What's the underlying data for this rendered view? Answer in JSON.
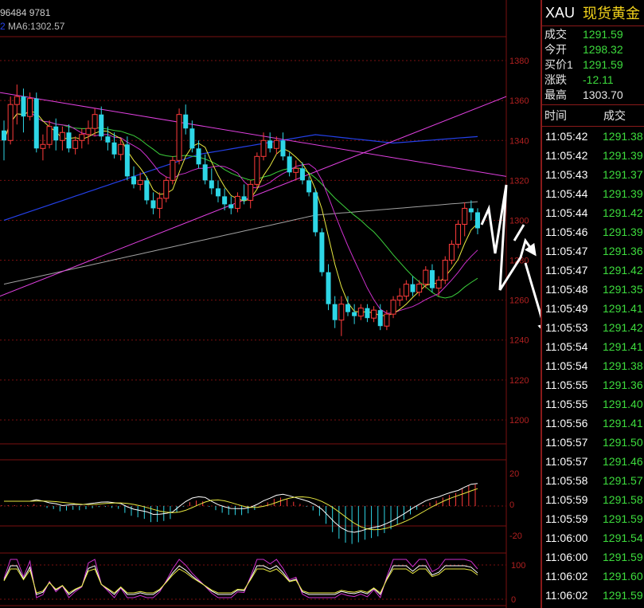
{
  "header": {
    "topline": "96484 9781",
    "ma_prefix": "2",
    "ma_label": "MA6:1302.57"
  },
  "colors": {
    "up": "#ff3b3b",
    "down": "#2ed6e6",
    "grid": "#7a0f0f",
    "axis_text": "#b02020",
    "trend": "#e040e0",
    "ma_yellow": "#e8e840",
    "ma_green": "#3ccf3c",
    "ma_blue": "#2440e8",
    "ma_gray": "#a0a0a0",
    "ma_magenta": "#cc30cc",
    "arrow": "#ffffff"
  },
  "chart_data": {
    "type": "candlestick",
    "y_ticks": [
      "1380",
      "1360",
      "1340",
      "1320",
      "1300",
      "1280",
      "1260",
      "1240",
      "1220",
      "1200"
    ],
    "ylim": [
      1188,
      1392
    ],
    "candles": [
      {
        "o": 1345,
        "h": 1350,
        "l": 1330,
        "c": 1340
      },
      {
        "o": 1340,
        "h": 1362,
        "l": 1338,
        "c": 1358
      },
      {
        "o": 1358,
        "h": 1368,
        "l": 1348,
        "c": 1362
      },
      {
        "o": 1362,
        "h": 1366,
        "l": 1344,
        "c": 1352
      },
      {
        "o": 1352,
        "h": 1364,
        "l": 1350,
        "c": 1361
      },
      {
        "o": 1361,
        "h": 1364,
        "l": 1334,
        "c": 1336
      },
      {
        "o": 1336,
        "h": 1343,
        "l": 1330,
        "c": 1338
      },
      {
        "o": 1338,
        "h": 1350,
        "l": 1336,
        "c": 1347
      },
      {
        "o": 1347,
        "h": 1351,
        "l": 1335,
        "c": 1340
      },
      {
        "o": 1340,
        "h": 1347,
        "l": 1335,
        "c": 1344
      },
      {
        "o": 1344,
        "h": 1348,
        "l": 1334,
        "c": 1336
      },
      {
        "o": 1336,
        "h": 1342,
        "l": 1333,
        "c": 1340
      },
      {
        "o": 1340,
        "h": 1346,
        "l": 1336,
        "c": 1343
      },
      {
        "o": 1343,
        "h": 1350,
        "l": 1338,
        "c": 1346
      },
      {
        "o": 1346,
        "h": 1356,
        "l": 1342,
        "c": 1353
      },
      {
        "o": 1353,
        "h": 1357,
        "l": 1340,
        "c": 1342
      },
      {
        "o": 1342,
        "h": 1347,
        "l": 1335,
        "c": 1339
      },
      {
        "o": 1339,
        "h": 1344,
        "l": 1331,
        "c": 1333
      },
      {
        "o": 1333,
        "h": 1341,
        "l": 1330,
        "c": 1338
      },
      {
        "o": 1338,
        "h": 1342,
        "l": 1320,
        "c": 1322
      },
      {
        "o": 1322,
        "h": 1327,
        "l": 1316,
        "c": 1318
      },
      {
        "o": 1318,
        "h": 1324,
        "l": 1315,
        "c": 1320
      },
      {
        "o": 1320,
        "h": 1322,
        "l": 1308,
        "c": 1310
      },
      {
        "o": 1310,
        "h": 1314,
        "l": 1303,
        "c": 1306
      },
      {
        "o": 1306,
        "h": 1314,
        "l": 1301,
        "c": 1311
      },
      {
        "o": 1311,
        "h": 1322,
        "l": 1309,
        "c": 1320
      },
      {
        "o": 1320,
        "h": 1332,
        "l": 1318,
        "c": 1330
      },
      {
        "o": 1330,
        "h": 1356,
        "l": 1328,
        "c": 1353
      },
      {
        "o": 1353,
        "h": 1358,
        "l": 1343,
        "c": 1346
      },
      {
        "o": 1346,
        "h": 1350,
        "l": 1334,
        "c": 1336
      },
      {
        "o": 1336,
        "h": 1340,
        "l": 1326,
        "c": 1328
      },
      {
        "o": 1328,
        "h": 1333,
        "l": 1318,
        "c": 1320
      },
      {
        "o": 1320,
        "h": 1326,
        "l": 1313,
        "c": 1316
      },
      {
        "o": 1316,
        "h": 1320,
        "l": 1309,
        "c": 1312
      },
      {
        "o": 1312,
        "h": 1316,
        "l": 1305,
        "c": 1308
      },
      {
        "o": 1308,
        "h": 1312,
        "l": 1303,
        "c": 1306
      },
      {
        "o": 1306,
        "h": 1314,
        "l": 1304,
        "c": 1312
      },
      {
        "o": 1312,
        "h": 1318,
        "l": 1308,
        "c": 1310
      },
      {
        "o": 1310,
        "h": 1320,
        "l": 1306,
        "c": 1318
      },
      {
        "o": 1318,
        "h": 1334,
        "l": 1316,
        "c": 1332
      },
      {
        "o": 1332,
        "h": 1344,
        "l": 1330,
        "c": 1340
      },
      {
        "o": 1340,
        "h": 1344,
        "l": 1334,
        "c": 1336
      },
      {
        "o": 1336,
        "h": 1342,
        "l": 1333,
        "c": 1340
      },
      {
        "o": 1340,
        "h": 1344,
        "l": 1330,
        "c": 1332
      },
      {
        "o": 1332,
        "h": 1334,
        "l": 1322,
        "c": 1324
      },
      {
        "o": 1324,
        "h": 1330,
        "l": 1320,
        "c": 1326
      },
      {
        "o": 1326,
        "h": 1329,
        "l": 1318,
        "c": 1320
      },
      {
        "o": 1320,
        "h": 1322,
        "l": 1312,
        "c": 1314
      },
      {
        "o": 1314,
        "h": 1316,
        "l": 1292,
        "c": 1294
      },
      {
        "o": 1294,
        "h": 1296,
        "l": 1272,
        "c": 1274
      },
      {
        "o": 1274,
        "h": 1278,
        "l": 1255,
        "c": 1258
      },
      {
        "o": 1258,
        "h": 1262,
        "l": 1246,
        "c": 1250
      },
      {
        "o": 1250,
        "h": 1262,
        "l": 1242,
        "c": 1258
      },
      {
        "o": 1258,
        "h": 1262,
        "l": 1252,
        "c": 1254
      },
      {
        "o": 1254,
        "h": 1258,
        "l": 1248,
        "c": 1252
      },
      {
        "o": 1252,
        "h": 1258,
        "l": 1250,
        "c": 1256
      },
      {
        "o": 1256,
        "h": 1258,
        "l": 1249,
        "c": 1251
      },
      {
        "o": 1251,
        "h": 1257,
        "l": 1249,
        "c": 1255
      },
      {
        "o": 1255,
        "h": 1258,
        "l": 1245,
        "c": 1247
      },
      {
        "o": 1247,
        "h": 1255,
        "l": 1245,
        "c": 1253
      },
      {
        "o": 1253,
        "h": 1262,
        "l": 1251,
        "c": 1260
      },
      {
        "o": 1260,
        "h": 1266,
        "l": 1257,
        "c": 1262
      },
      {
        "o": 1262,
        "h": 1270,
        "l": 1260,
        "c": 1268
      },
      {
        "o": 1268,
        "h": 1272,
        "l": 1262,
        "c": 1264
      },
      {
        "o": 1264,
        "h": 1270,
        "l": 1262,
        "c": 1268
      },
      {
        "o": 1268,
        "h": 1277,
        "l": 1266,
        "c": 1275
      },
      {
        "o": 1275,
        "h": 1278,
        "l": 1264,
        "c": 1266
      },
      {
        "o": 1266,
        "h": 1272,
        "l": 1262,
        "c": 1270
      },
      {
        "o": 1270,
        "h": 1282,
        "l": 1268,
        "c": 1280
      },
      {
        "o": 1280,
        "h": 1290,
        "l": 1278,
        "c": 1288
      },
      {
        "o": 1288,
        "h": 1300,
        "l": 1286,
        "c": 1298
      },
      {
        "o": 1298,
        "h": 1309,
        "l": 1292,
        "c": 1306
      },
      {
        "o": 1306,
        "h": 1310,
        "l": 1300,
        "c": 1304
      },
      {
        "o": 1304,
        "h": 1306,
        "l": 1293,
        "c": 1296
      }
    ],
    "macd_ticks": [
      "20",
      "0",
      "-20"
    ],
    "kdj_ticks": [
      "100",
      "0"
    ]
  },
  "quote": {
    "code": "XAU",
    "name": "现货黄金",
    "rows": [
      {
        "label": "成交",
        "value": "1291.59",
        "color": "green"
      },
      {
        "label": "今开",
        "value": "1298.32",
        "color": "green"
      },
      {
        "label": "买价1",
        "value": "1291.59",
        "color": "green"
      },
      {
        "label": "涨跌",
        "value": "-12.11",
        "color": "green"
      },
      {
        "label": "最高",
        "value": "1303.70",
        "color": "white"
      }
    ]
  },
  "ticks": {
    "header_time": "时间",
    "header_price": "成交",
    "rows": [
      {
        "time": "11:05:42",
        "price": "1291.38"
      },
      {
        "time": "11:05:42",
        "price": "1291.39"
      },
      {
        "time": "11:05:43",
        "price": "1291.37"
      },
      {
        "time": "11:05:44",
        "price": "1291.39"
      },
      {
        "time": "11:05:44",
        "price": "1291.42"
      },
      {
        "time": "11:05:46",
        "price": "1291.39"
      },
      {
        "time": "11:05:47",
        "price": "1291.36"
      },
      {
        "time": "11:05:47",
        "price": "1291.42"
      },
      {
        "time": "11:05:48",
        "price": "1291.35"
      },
      {
        "time": "11:05:49",
        "price": "1291.41"
      },
      {
        "time": "11:05:53",
        "price": "1291.42"
      },
      {
        "time": "11:05:54",
        "price": "1291.41"
      },
      {
        "time": "11:05:54",
        "price": "1291.38"
      },
      {
        "time": "11:05:55",
        "price": "1291.36"
      },
      {
        "time": "11:05:55",
        "price": "1291.40"
      },
      {
        "time": "11:05:56",
        "price": "1291.41"
      },
      {
        "time": "11:05:57",
        "price": "1291.50"
      },
      {
        "time": "11:05:57",
        "price": "1291.46"
      },
      {
        "time": "11:05:58",
        "price": "1291.57"
      },
      {
        "time": "11:05:59",
        "price": "1291.58"
      },
      {
        "time": "11:05:59",
        "price": "1291.59"
      },
      {
        "time": "11:06:00",
        "price": "1291.54"
      },
      {
        "time": "11:06:00",
        "price": "1291.59"
      },
      {
        "time": "11:06:02",
        "price": "1291.60"
      },
      {
        "time": "11:06:02",
        "price": "1291.59"
      }
    ]
  }
}
